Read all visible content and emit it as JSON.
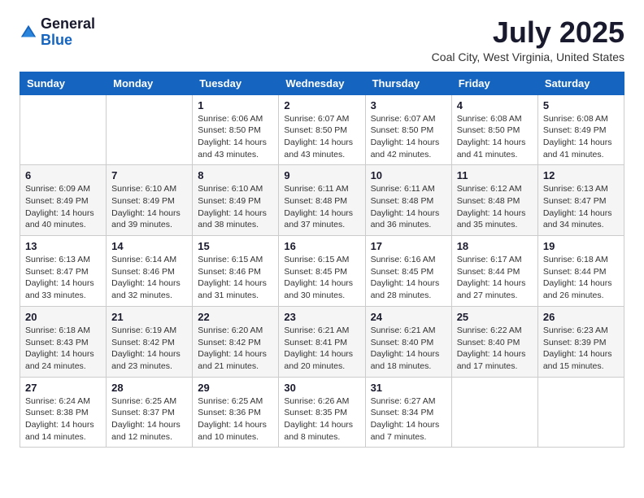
{
  "header": {
    "logo_general": "General",
    "logo_blue": "Blue",
    "month_title": "July 2025",
    "location": "Coal City, West Virginia, United States"
  },
  "calendar": {
    "days_of_week": [
      "Sunday",
      "Monday",
      "Tuesday",
      "Wednesday",
      "Thursday",
      "Friday",
      "Saturday"
    ],
    "weeks": [
      [
        {
          "day": "",
          "info": ""
        },
        {
          "day": "",
          "info": ""
        },
        {
          "day": "1",
          "info": "Sunrise: 6:06 AM\nSunset: 8:50 PM\nDaylight: 14 hours and 43 minutes."
        },
        {
          "day": "2",
          "info": "Sunrise: 6:07 AM\nSunset: 8:50 PM\nDaylight: 14 hours and 43 minutes."
        },
        {
          "day": "3",
          "info": "Sunrise: 6:07 AM\nSunset: 8:50 PM\nDaylight: 14 hours and 42 minutes."
        },
        {
          "day": "4",
          "info": "Sunrise: 6:08 AM\nSunset: 8:50 PM\nDaylight: 14 hours and 41 minutes."
        },
        {
          "day": "5",
          "info": "Sunrise: 6:08 AM\nSunset: 8:49 PM\nDaylight: 14 hours and 41 minutes."
        }
      ],
      [
        {
          "day": "6",
          "info": "Sunrise: 6:09 AM\nSunset: 8:49 PM\nDaylight: 14 hours and 40 minutes."
        },
        {
          "day": "7",
          "info": "Sunrise: 6:10 AM\nSunset: 8:49 PM\nDaylight: 14 hours and 39 minutes."
        },
        {
          "day": "8",
          "info": "Sunrise: 6:10 AM\nSunset: 8:49 PM\nDaylight: 14 hours and 38 minutes."
        },
        {
          "day": "9",
          "info": "Sunrise: 6:11 AM\nSunset: 8:48 PM\nDaylight: 14 hours and 37 minutes."
        },
        {
          "day": "10",
          "info": "Sunrise: 6:11 AM\nSunset: 8:48 PM\nDaylight: 14 hours and 36 minutes."
        },
        {
          "day": "11",
          "info": "Sunrise: 6:12 AM\nSunset: 8:48 PM\nDaylight: 14 hours and 35 minutes."
        },
        {
          "day": "12",
          "info": "Sunrise: 6:13 AM\nSunset: 8:47 PM\nDaylight: 14 hours and 34 minutes."
        }
      ],
      [
        {
          "day": "13",
          "info": "Sunrise: 6:13 AM\nSunset: 8:47 PM\nDaylight: 14 hours and 33 minutes."
        },
        {
          "day": "14",
          "info": "Sunrise: 6:14 AM\nSunset: 8:46 PM\nDaylight: 14 hours and 32 minutes."
        },
        {
          "day": "15",
          "info": "Sunrise: 6:15 AM\nSunset: 8:46 PM\nDaylight: 14 hours and 31 minutes."
        },
        {
          "day": "16",
          "info": "Sunrise: 6:15 AM\nSunset: 8:45 PM\nDaylight: 14 hours and 30 minutes."
        },
        {
          "day": "17",
          "info": "Sunrise: 6:16 AM\nSunset: 8:45 PM\nDaylight: 14 hours and 28 minutes."
        },
        {
          "day": "18",
          "info": "Sunrise: 6:17 AM\nSunset: 8:44 PM\nDaylight: 14 hours and 27 minutes."
        },
        {
          "day": "19",
          "info": "Sunrise: 6:18 AM\nSunset: 8:44 PM\nDaylight: 14 hours and 26 minutes."
        }
      ],
      [
        {
          "day": "20",
          "info": "Sunrise: 6:18 AM\nSunset: 8:43 PM\nDaylight: 14 hours and 24 minutes."
        },
        {
          "day": "21",
          "info": "Sunrise: 6:19 AM\nSunset: 8:42 PM\nDaylight: 14 hours and 23 minutes."
        },
        {
          "day": "22",
          "info": "Sunrise: 6:20 AM\nSunset: 8:42 PM\nDaylight: 14 hours and 21 minutes."
        },
        {
          "day": "23",
          "info": "Sunrise: 6:21 AM\nSunset: 8:41 PM\nDaylight: 14 hours and 20 minutes."
        },
        {
          "day": "24",
          "info": "Sunrise: 6:21 AM\nSunset: 8:40 PM\nDaylight: 14 hours and 18 minutes."
        },
        {
          "day": "25",
          "info": "Sunrise: 6:22 AM\nSunset: 8:40 PM\nDaylight: 14 hours and 17 minutes."
        },
        {
          "day": "26",
          "info": "Sunrise: 6:23 AM\nSunset: 8:39 PM\nDaylight: 14 hours and 15 minutes."
        }
      ],
      [
        {
          "day": "27",
          "info": "Sunrise: 6:24 AM\nSunset: 8:38 PM\nDaylight: 14 hours and 14 minutes."
        },
        {
          "day": "28",
          "info": "Sunrise: 6:25 AM\nSunset: 8:37 PM\nDaylight: 14 hours and 12 minutes."
        },
        {
          "day": "29",
          "info": "Sunrise: 6:25 AM\nSunset: 8:36 PM\nDaylight: 14 hours and 10 minutes."
        },
        {
          "day": "30",
          "info": "Sunrise: 6:26 AM\nSunset: 8:35 PM\nDaylight: 14 hours and 8 minutes."
        },
        {
          "day": "31",
          "info": "Sunrise: 6:27 AM\nSunset: 8:34 PM\nDaylight: 14 hours and 7 minutes."
        },
        {
          "day": "",
          "info": ""
        },
        {
          "day": "",
          "info": ""
        }
      ]
    ]
  }
}
